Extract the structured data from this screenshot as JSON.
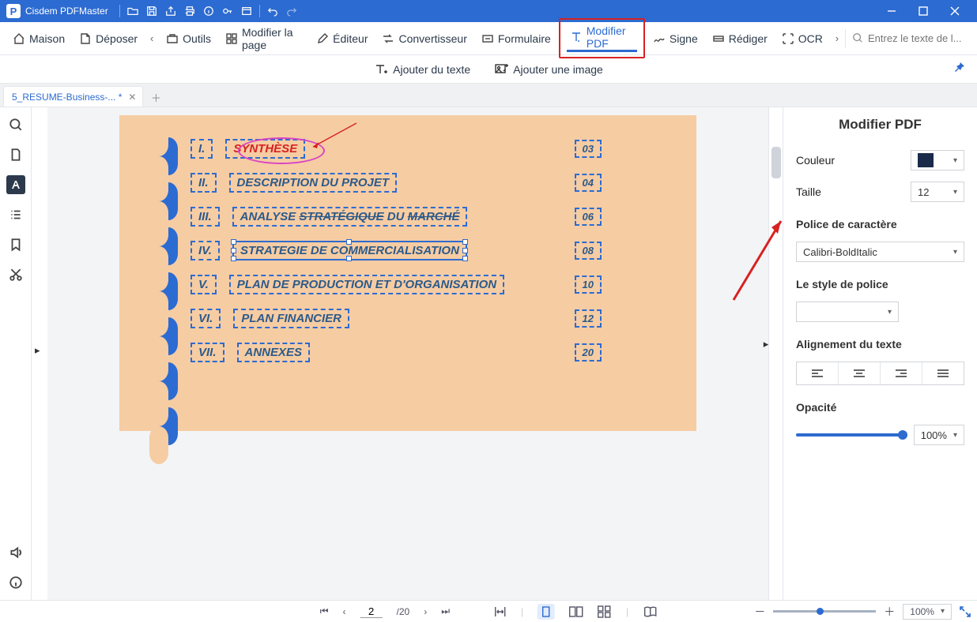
{
  "app": {
    "title": "Cisdem PDFMaster"
  },
  "mainnav": {
    "maison": "Maison",
    "deposer": "Déposer",
    "outils": "Outils",
    "modifier_page": "Modifier la page",
    "editeur": "Éditeur",
    "convertisseur": "Convertisseur",
    "formulaire": "Formulaire",
    "modifier_pdf": "Modifier PDF",
    "signe": "Signe",
    "rediger": "Rédiger",
    "ocr": "OCR",
    "search_ph": "Entrez le texte de l..."
  },
  "subbar": {
    "add_text": "Ajouter du texte",
    "add_image": "Ajouter une image"
  },
  "tabs": {
    "doc1": "5_RESUME-Business-... *"
  },
  "toc": [
    {
      "num": "I.",
      "title": "SYNTHÈSE",
      "page": "03"
    },
    {
      "num": "II.",
      "title": "DESCRIPTION DU PROJET",
      "page": "04"
    },
    {
      "num": "III.",
      "title": "ANALYSE STRATÉGIQUE DU MARCHÉ",
      "page": "06"
    },
    {
      "num": "IV.",
      "title": "STRATEGIE DE COMMERCIALISATION",
      "page": "08"
    },
    {
      "num": "V.",
      "title": "PLAN DE PRODUCTION ET D'ORGANISATION",
      "page": "10"
    },
    {
      "num": "VI.",
      "title": "PLAN FINANCIER",
      "page": "12"
    },
    {
      "num": "VII.",
      "title": "ANNEXES",
      "page": "20"
    }
  ],
  "rightpanel": {
    "title": "Modifier PDF",
    "couleur": "Couleur",
    "taille": "Taille",
    "taille_val": "12",
    "police_label": "Police de caractère",
    "police_val": "Calibri-BoldItalic",
    "style_label": "Le style de police",
    "style_val": "",
    "align_label": "Alignement du texte",
    "opacity_label": "Opacité",
    "opacity_val": "100%",
    "color_hex": "#1a2b4a"
  },
  "status": {
    "page_current": "2",
    "page_total": "/20",
    "zoom": "100%"
  }
}
